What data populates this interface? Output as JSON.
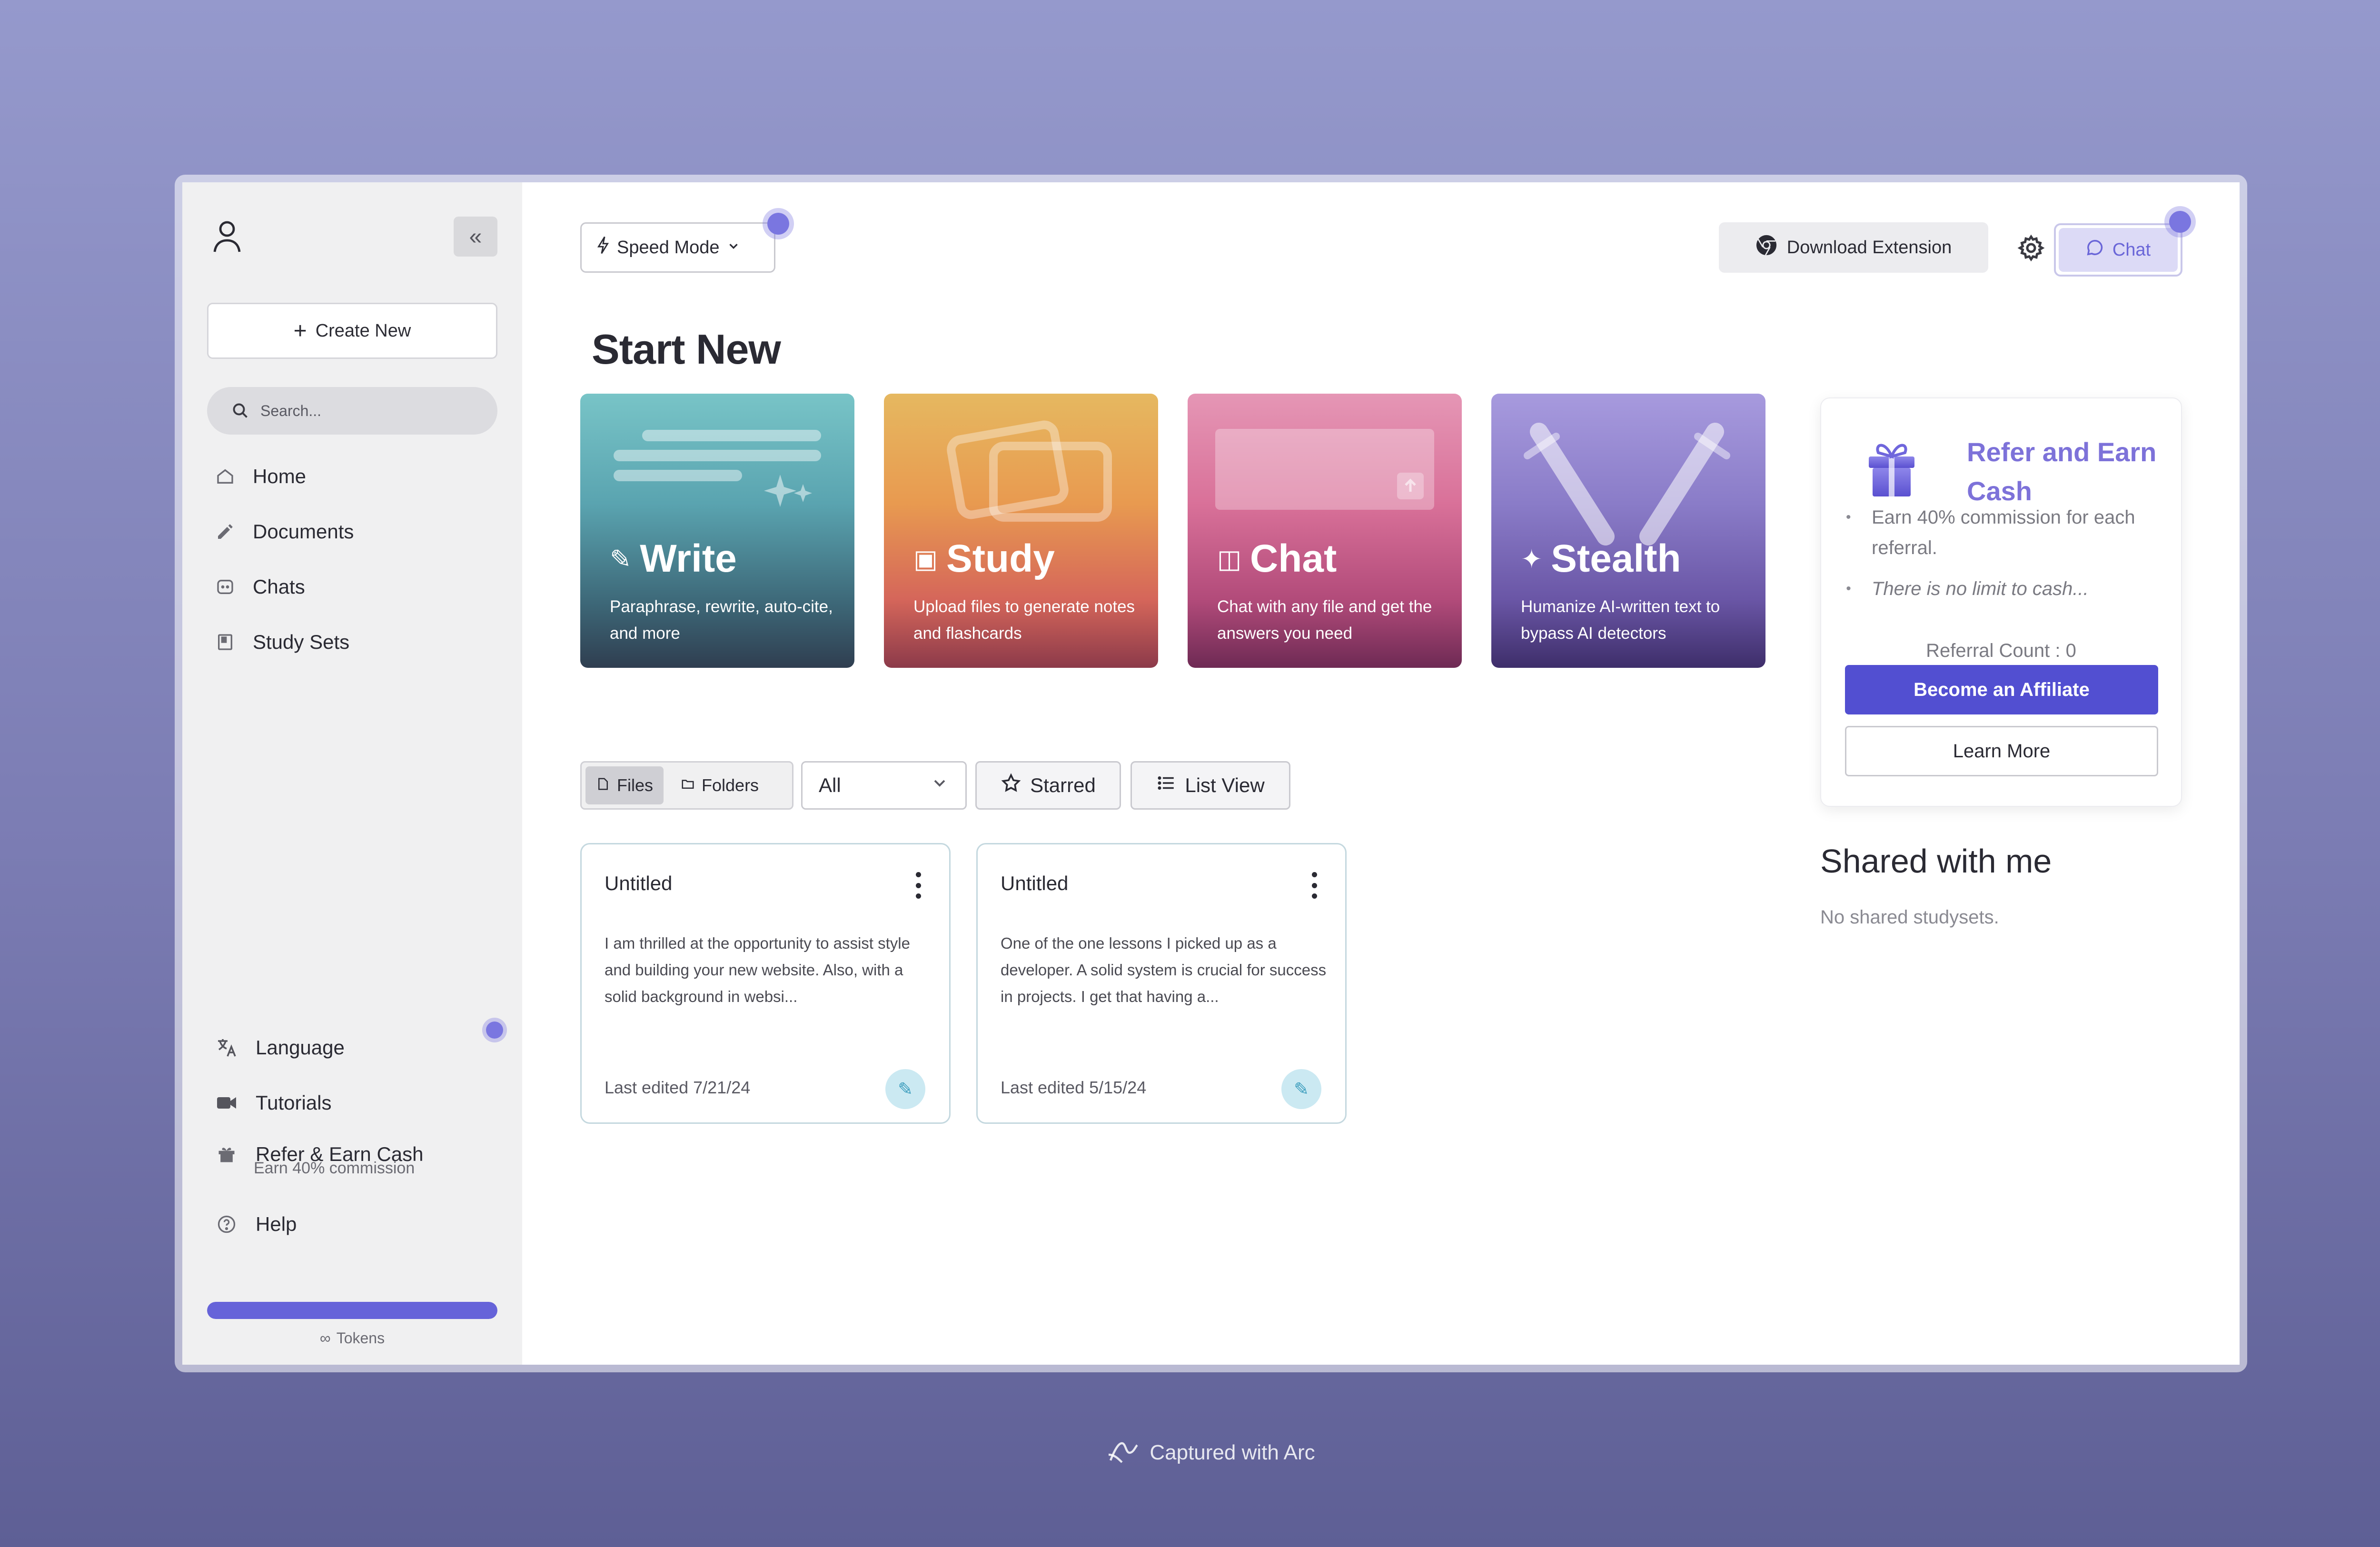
{
  "sidebar": {
    "create_new": "Create New",
    "search_placeholder": "Search...",
    "nav": [
      {
        "label": "Home",
        "icon": "home-icon"
      },
      {
        "label": "Documents",
        "icon": "pencil-icon"
      },
      {
        "label": "Chats",
        "icon": "chat-icon"
      },
      {
        "label": "Study Sets",
        "icon": "book-icon"
      }
    ],
    "bottom": {
      "language": "Language",
      "tutorials": "Tutorials",
      "refer": "Refer & Earn Cash",
      "refer_sub": "Earn 40% commission",
      "help": "Help"
    },
    "token_progress": 1.0,
    "tokens_label": "Tokens"
  },
  "toolbar": {
    "speed_mode": "Speed Mode",
    "download_extension": "Download Extension",
    "chat": "Chat"
  },
  "main": {
    "start_title": "Start New",
    "cards": [
      {
        "title": "Write",
        "desc": "Paraphrase, rewrite, auto-cite, and more"
      },
      {
        "title": "Study",
        "desc": "Upload files to generate notes and flashcards"
      },
      {
        "title": "Chat",
        "desc": "Chat with any file and get the answers you need"
      },
      {
        "title": "Stealth",
        "desc": "Humanize AI-written text to bypass AI detectors"
      }
    ],
    "tabs": {
      "files": "Files",
      "folders": "Folders"
    },
    "filter_value": "All",
    "starred": "Starred",
    "list_view": "List View",
    "documents": [
      {
        "title": "Untitled",
        "body": "I am thrilled at the opportunity to assist style and building your new website. Also, with a solid background in websi...",
        "edited": "Last edited 7/21/24"
      },
      {
        "title": "Untitled",
        "body": "One of the one lessons I picked up as a developer. A solid system is crucial for success in projects. I get that having a...",
        "edited": "Last edited 5/15/24"
      }
    ]
  },
  "refer_panel": {
    "title": "Refer and Earn Cash",
    "bullets": [
      "Earn 40% commission for each referral.",
      "There is no limit to cash..."
    ],
    "referral_count": "Referral Count : 0",
    "affiliate_button": "Become an Affiliate",
    "learn_more": "Learn More"
  },
  "shared": {
    "title": "Shared with me",
    "empty": "No shared studysets."
  },
  "footer": {
    "captured": "Captured with Arc"
  },
  "colors": {
    "accent": "#524fd1",
    "chat_accent": "#6a66d8",
    "refer_title": "#7d72d9"
  }
}
